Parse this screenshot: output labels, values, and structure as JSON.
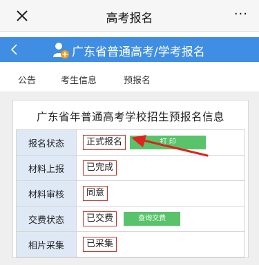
{
  "nav": {
    "title": "高考报名",
    "more": "···"
  },
  "banner": {
    "title": "广东省普通高考/学考报名"
  },
  "tabs": [
    "公告",
    "考生信息",
    "预报名"
  ],
  "card": {
    "title": "广东省年普通高考学校招生预报名信息",
    "rows": [
      {
        "label": "报名状态",
        "value": "正式报名",
        "button": "打 印"
      },
      {
        "label": "材料上报",
        "value": "已完成"
      },
      {
        "label": "材料审核",
        "value": "同意"
      },
      {
        "label": "交费状态",
        "value": "已交费",
        "button": "查询交费"
      },
      {
        "label": "相片采集",
        "value": "已采集"
      }
    ]
  },
  "colors": {
    "banner": "#3f8ee3",
    "label_cell": "#dfe9f6",
    "button": "#58c36a",
    "highlight": "#c0392b"
  },
  "icons": {
    "close": "close-icon",
    "more": "more-icon",
    "back": "back-icon",
    "logo": "user-plus-icon",
    "arrow": "red-arrow-annotation"
  }
}
